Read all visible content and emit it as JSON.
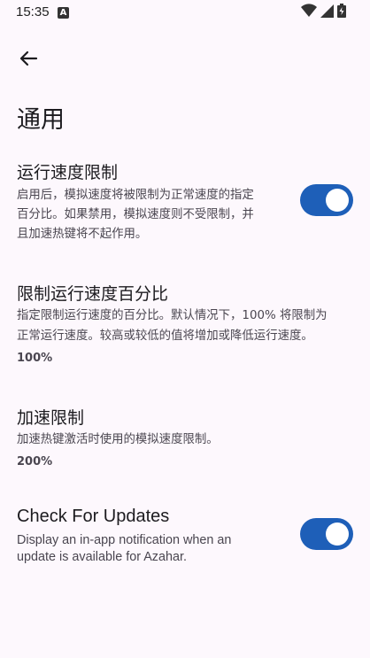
{
  "status_bar": {
    "time": "15:35",
    "notif_icon": "A"
  },
  "header": {
    "title": "通用"
  },
  "settings": [
    {
      "title": "运行速度限制",
      "desc_lines": [
        "启用后，模拟速度将被限制为正常速度的指定",
        "百分比。如果禁用，模拟速度则不受限制，并",
        "且加速热键将不起作用。"
      ],
      "toggle": true
    },
    {
      "title": "限制运行速度百分比",
      "desc_lines": [
        "指定限制运行速度的百分比。默认情况下，100% 将限制为",
        "正常运行速度。较高或较低的值将增加或降低运行速度。"
      ],
      "value": "100%"
    },
    {
      "title": "加速限制",
      "desc_lines": [
        "加速热键激活时使用的模拟速度限制。"
      ],
      "value": "200%"
    },
    {
      "title": "Check For Updates",
      "desc_lines": [
        "Display an in-app notification when an",
        "update is available for Azahar."
      ],
      "toggle": true
    }
  ],
  "colors": {
    "accent": "#1e5fb8",
    "background": "#fdf8fd"
  }
}
